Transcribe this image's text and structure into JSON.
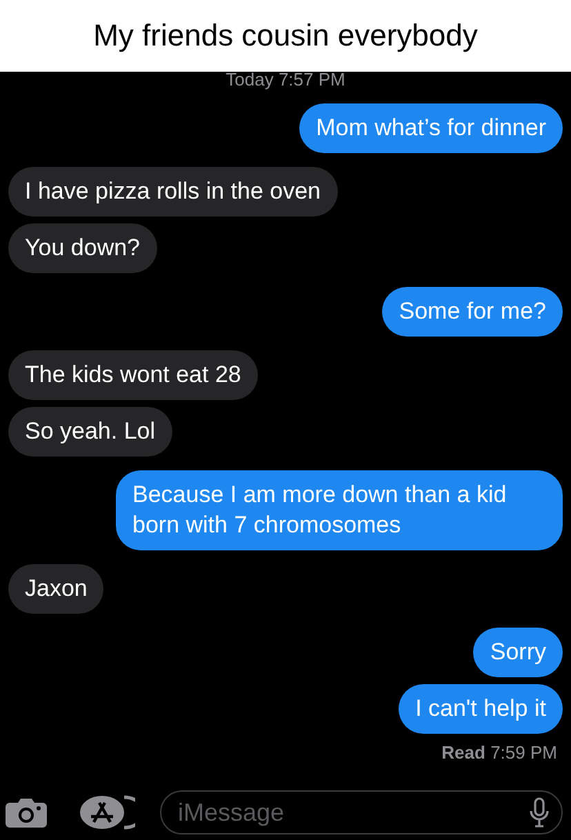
{
  "caption": "My friends cousin everybody",
  "timestamp": "Today 7:57 PM",
  "messages": [
    {
      "kind": "sent",
      "text": "Mom what’s for dinner"
    },
    {
      "kind": "received",
      "text": "I have pizza rolls in the oven"
    },
    {
      "kind": "received",
      "text": "You down?"
    },
    {
      "kind": "sent",
      "text": "Some for me?"
    },
    {
      "kind": "received",
      "text": "The kids wont eat 28"
    },
    {
      "kind": "received",
      "text": "So yeah. Lol"
    },
    {
      "kind": "sent",
      "text": "Because I am more down than a kid born with 7 chromosomes"
    },
    {
      "kind": "received",
      "text": "Jaxon"
    },
    {
      "kind": "sent",
      "text": "Sorry"
    },
    {
      "kind": "sent",
      "text": "I can't help it"
    }
  ],
  "read_receipt": {
    "label": "Read",
    "time": "7:59 PM"
  },
  "compose": {
    "placeholder": "iMessage"
  }
}
